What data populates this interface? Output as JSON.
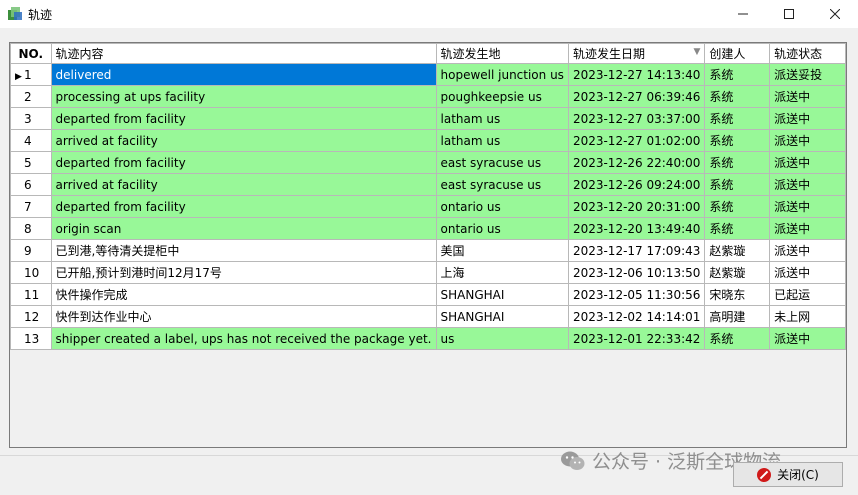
{
  "window": {
    "title": "轨迹"
  },
  "table": {
    "headers": {
      "no": "NO.",
      "content": "轨迹内容",
      "place": "轨迹发生地",
      "date": "轨迹发生日期",
      "creator": "创建人",
      "status": "轨迹状态"
    },
    "rows": [
      {
        "no": "1",
        "content": "delivered",
        "place": "hopewell junction us",
        "date": "2023-12-27 14:13:40",
        "creator": "系统",
        "status": "派送妥投"
      },
      {
        "no": "2",
        "content": "processing at ups facility",
        "place": "poughkeepsie us",
        "date": "2023-12-27 06:39:46",
        "creator": "系统",
        "status": "派送中"
      },
      {
        "no": "3",
        "content": "departed from facility",
        "place": "latham us",
        "date": "2023-12-27 03:37:00",
        "creator": "系统",
        "status": "派送中"
      },
      {
        "no": "4",
        "content": "arrived at facility",
        "place": "latham us",
        "date": "2023-12-27 01:02:00",
        "creator": "系统",
        "status": "派送中"
      },
      {
        "no": "5",
        "content": "departed from facility",
        "place": "east syracuse us",
        "date": "2023-12-26 22:40:00",
        "creator": "系统",
        "status": "派送中"
      },
      {
        "no": "6",
        "content": "arrived at facility",
        "place": "east syracuse us",
        "date": "2023-12-26 09:24:00",
        "creator": "系统",
        "status": "派送中"
      },
      {
        "no": "7",
        "content": "departed from facility",
        "place": "ontario us",
        "date": "2023-12-20 20:31:00",
        "creator": "系统",
        "status": "派送中"
      },
      {
        "no": "8",
        "content": "origin scan",
        "place": "ontario us",
        "date": "2023-12-20 13:49:40",
        "creator": "系统",
        "status": "派送中"
      },
      {
        "no": "9",
        "content": "已到港,等待清关提柜中",
        "place": "美国",
        "date": "2023-12-17 17:09:43",
        "creator": "赵紫璇",
        "status": "派送中"
      },
      {
        "no": "10",
        "content": "已开船,预计到港时间12月17号",
        "place": "上海",
        "date": "2023-12-06 10:13:50",
        "creator": "赵紫璇",
        "status": "派送中"
      },
      {
        "no": "11",
        "content": "快件操作完成",
        "place": "SHANGHAI",
        "date": "2023-12-05 11:30:56",
        "creator": "宋晓东",
        "status": "已起运"
      },
      {
        "no": "12",
        "content": "快件到达作业中心",
        "place": "SHANGHAI",
        "date": "2023-12-02 14:14:01",
        "creator": "高明建",
        "status": "未上网"
      },
      {
        "no": "13",
        "content": "shipper created a label, ups has not received the package yet.",
        "place": " us",
        "date": "2023-12-01 22:33:42",
        "creator": "系统",
        "status": "派送中"
      }
    ]
  },
  "footer": {
    "close_label": "关闭(C)",
    "watermark": "公众号 · 泛斯全球物流"
  },
  "colors": {
    "green_row": "#98f898",
    "selected": "#0078d7"
  }
}
